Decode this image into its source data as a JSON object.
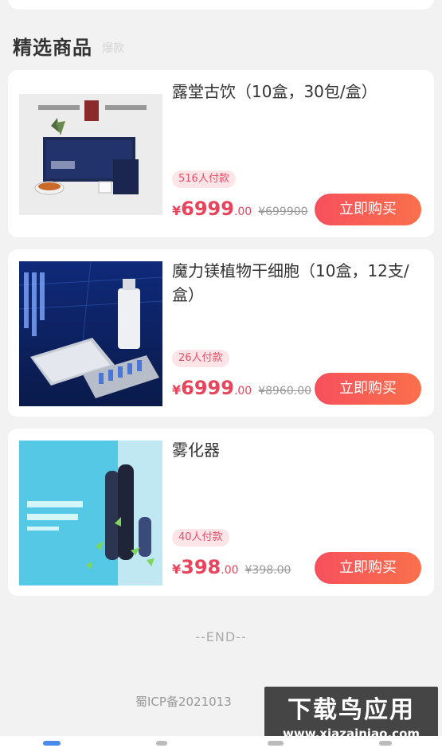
{
  "section": {
    "title": "精选商品",
    "subtitle": "爆款"
  },
  "products": [
    {
      "name": "露堂古饮（10盒，30包/盒）",
      "sold": "516人付款",
      "price_symbol": "¥",
      "price_int": "6999",
      "price_cents": ".00",
      "original_price": "¥699900",
      "buy_label": "立即购买",
      "image": "tea-gift-box-image"
    },
    {
      "name": "魔力镁植物干细胞（10盒，12支/盒）",
      "sold": "26人付款",
      "price_symbol": "¥",
      "price_int": "6999",
      "price_cents": ".00",
      "original_price": "¥8960.00",
      "buy_label": "立即购买",
      "image": "stem-cell-kit-image"
    },
    {
      "name": "雾化器",
      "sold": "40人付款",
      "price_symbol": "¥",
      "price_int": "398",
      "price_cents": ".00",
      "original_price": "¥398.00",
      "buy_label": "立即购买",
      "image": "atomizer-image"
    }
  ],
  "footer": {
    "end": "--END--",
    "icp": "蜀ICP备2021013"
  },
  "watermark": {
    "title": "下载鸟应用",
    "url": "www.xiazainiao.com"
  },
  "colors": {
    "accent": "#e8445c",
    "button_start": "#f7505d",
    "button_end": "#f9704b",
    "badge_bg": "#fde4e7"
  }
}
